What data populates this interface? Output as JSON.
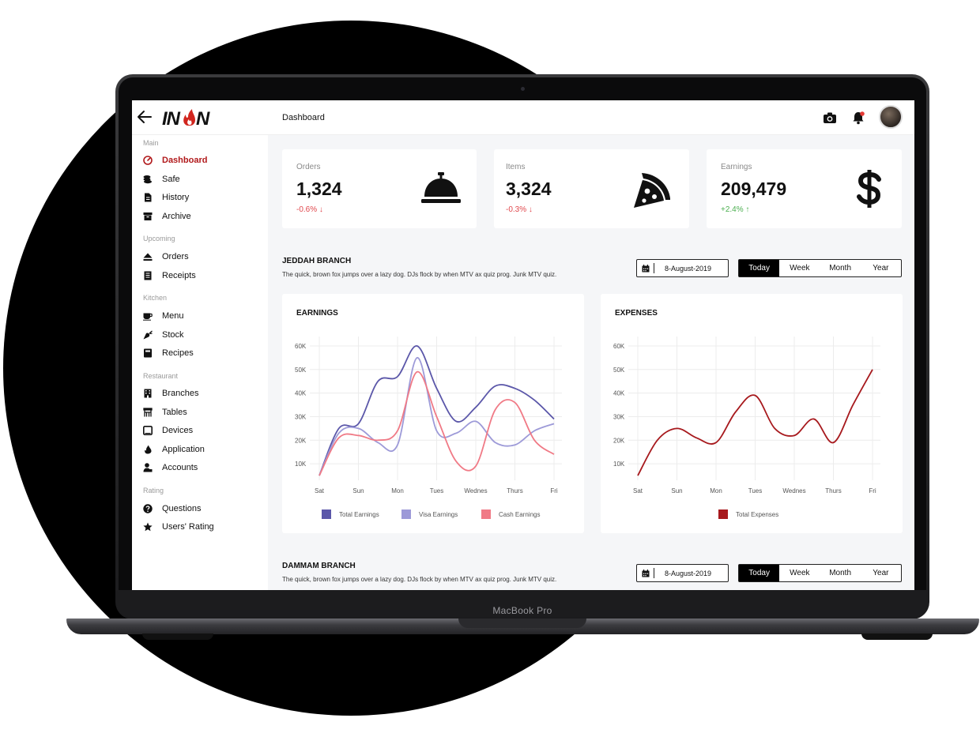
{
  "device": {
    "brand": "MacBook Pro"
  },
  "app": {
    "logo_text": "INON",
    "page_title": "Dashboard"
  },
  "header_icons": [
    "camera-icon",
    "bell-icon"
  ],
  "colors": {
    "accent": "#b1191b",
    "total": "#5b57a9",
    "visa": "#9d9ad8",
    "cash": "#f07a86",
    "expenses": "#a7191d"
  },
  "sidebar": {
    "sections": [
      {
        "title": "Main",
        "items": [
          {
            "label": "Dashboard",
            "icon": "gauge-icon",
            "active": true
          },
          {
            "label": "Safe",
            "icon": "coins-icon"
          },
          {
            "label": "History",
            "icon": "file-icon"
          },
          {
            "label": "Archive",
            "icon": "archive-icon"
          }
        ]
      },
      {
        "title": "Upcoming",
        "items": [
          {
            "label": "Orders",
            "icon": "eject-icon"
          },
          {
            "label": "Receipts",
            "icon": "receipt-icon"
          }
        ]
      },
      {
        "title": "Kitchen",
        "items": [
          {
            "label": "Menu",
            "icon": "coffee-icon"
          },
          {
            "label": "Stock",
            "icon": "carrot-icon"
          },
          {
            "label": "Recipes",
            "icon": "book-icon"
          }
        ]
      },
      {
        "title": "Restaurant",
        "items": [
          {
            "label": "Branches",
            "icon": "building-icon"
          },
          {
            "label": "Tables",
            "icon": "table-icon"
          },
          {
            "label": "Devices",
            "icon": "tablet-icon"
          },
          {
            "label": "Application",
            "icon": "flame-icon"
          },
          {
            "label": "Accounts",
            "icon": "user-tie-icon"
          }
        ]
      },
      {
        "title": "Rating",
        "items": [
          {
            "label": "Questions",
            "icon": "question-icon"
          },
          {
            "label": "Users' Rating",
            "icon": "star-icon"
          }
        ]
      }
    ]
  },
  "stats": [
    {
      "label": "Orders",
      "value": "1,324",
      "delta": "-0.6% ↓",
      "trend": "neg",
      "icon": "service-bell-icon"
    },
    {
      "label": "Items",
      "value": "3,324",
      "delta": "-0.3% ↓",
      "trend": "neg",
      "icon": "pizza-slice-icon"
    },
    {
      "label": "Earnings",
      "value": "209,479",
      "delta": "+2.4% ↑",
      "trend": "pos",
      "icon": "dollar-icon"
    }
  ],
  "branches": [
    {
      "title": "JEDDAH BRANCH",
      "desc": "The quick, brown fox jumps over a lazy dog. DJs flock by when MTV ax quiz prog. Junk MTV quiz.",
      "date": "8-August-2019",
      "ranges": [
        "Today",
        "Week",
        "Month",
        "Year"
      ],
      "selected_range": "Today"
    },
    {
      "title": "DAMMAM BRANCH",
      "desc": "The quick, brown fox jumps over a lazy dog. DJs flock by when MTV ax quiz prog. Junk MTV quiz.",
      "date": "8-August-2019",
      "ranges": [
        "Today",
        "Week",
        "Month",
        "Year"
      ],
      "selected_range": "Today"
    }
  ],
  "chart_data": [
    {
      "type": "line",
      "title": "EARNINGS",
      "categories": [
        "Sat",
        "Sun",
        "Mon",
        "Tues",
        "Wednes",
        "Thurs",
        "Fri"
      ],
      "x": [
        0,
        0.5,
        1,
        1.5,
        2,
        2.5,
        3,
        3.5,
        4,
        4.5,
        5,
        5.5,
        6
      ],
      "yticks": [
        10000,
        20000,
        30000,
        40000,
        50000,
        60000
      ],
      "ytick_labels": [
        "10K",
        "20K",
        "30K",
        "40K",
        "50K",
        "60K"
      ],
      "ylim": [
        3000,
        62000
      ],
      "grid": true,
      "legend_position": "bottom",
      "series": [
        {
          "name": "Total Earnings",
          "color": "#5b57a9",
          "values": [
            5000,
            25000,
            27000,
            45000,
            47000,
            60000,
            42000,
            28000,
            34000,
            43000,
            42000,
            37000,
            29000
          ]
        },
        {
          "name": "Visa Earnings",
          "color": "#9d9ad8",
          "values": [
            5000,
            23000,
            25000,
            19000,
            18000,
            55000,
            24000,
            23000,
            28000,
            19000,
            18000,
            24000,
            27000
          ]
        },
        {
          "name": "Cash Earnings",
          "color": "#f07a86",
          "values": [
            5000,
            21000,
            22000,
            20000,
            24000,
            49000,
            30000,
            11000,
            9000,
            33000,
            36000,
            20000,
            14000
          ]
        }
      ]
    },
    {
      "type": "line",
      "title": "EXPENSES",
      "categories": [
        "Sat",
        "Sun",
        "Mon",
        "Tues",
        "Wednes",
        "Thurs",
        "Fri"
      ],
      "x": [
        0,
        0.5,
        1,
        1.5,
        2,
        2.5,
        3,
        3.5,
        4,
        4.5,
        5,
        5.5,
        6
      ],
      "yticks": [
        10000,
        20000,
        30000,
        40000,
        50000,
        60000
      ],
      "ytick_labels": [
        "10K",
        "20K",
        "30K",
        "40K",
        "50K",
        "60K"
      ],
      "ylim": [
        3000,
        62000
      ],
      "grid": true,
      "legend_position": "bottom",
      "series": [
        {
          "name": "Total Expenses",
          "color": "#a7191d",
          "values": [
            5000,
            20000,
            25000,
            21000,
            19000,
            32000,
            39000,
            25000,
            22000,
            29000,
            19000,
            35000,
            50000
          ]
        }
      ]
    }
  ]
}
